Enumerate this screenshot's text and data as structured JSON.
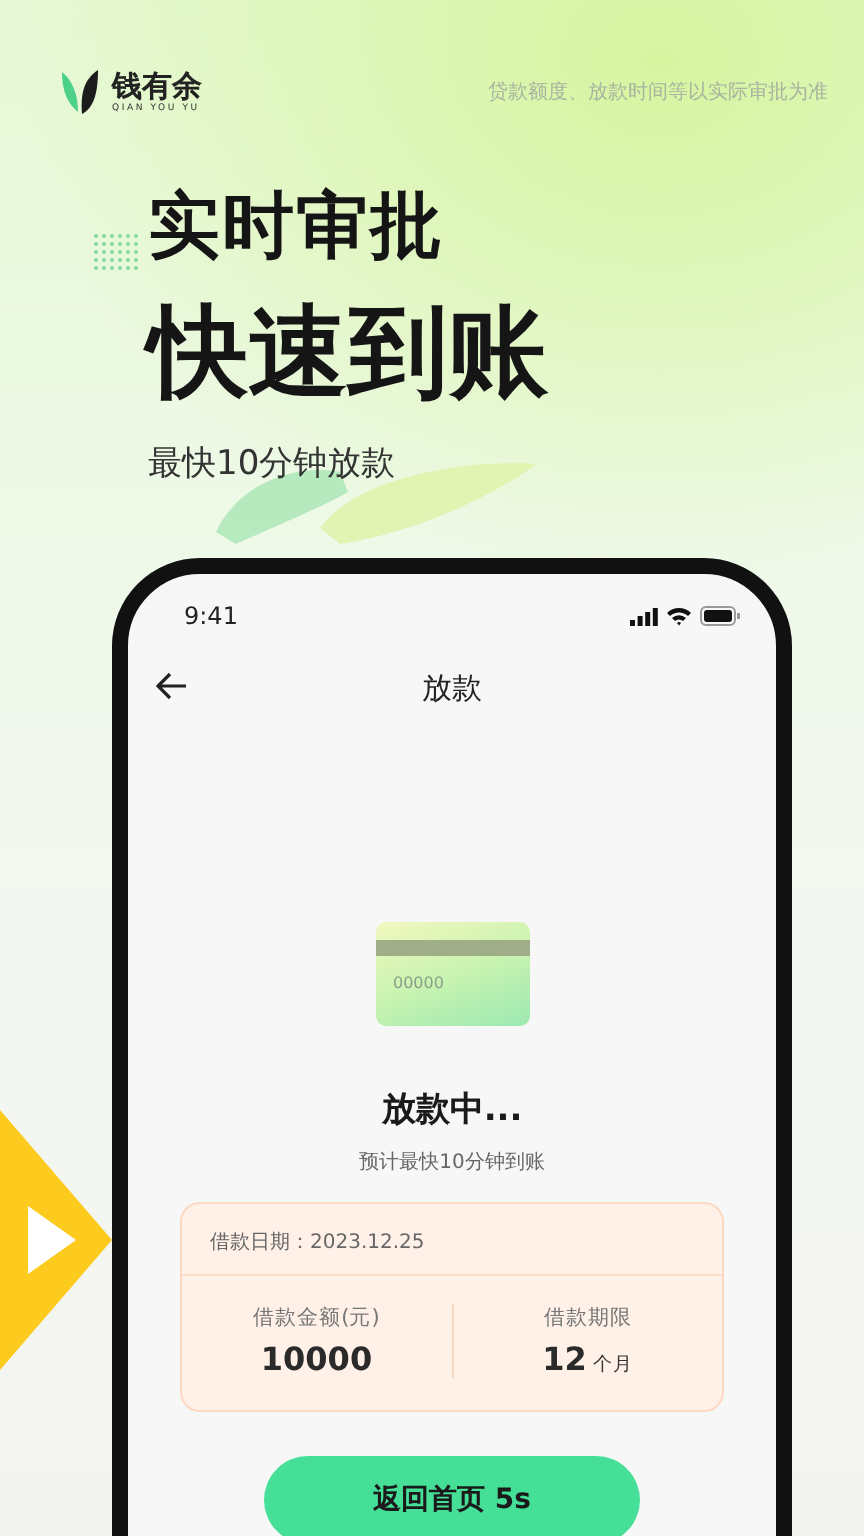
{
  "brand": {
    "name": "钱有余",
    "subtitle": "QIAN YOU YU"
  },
  "disclaimer": "贷款额度、放款时间等以实际审批为准",
  "headline": {
    "line_1": "实时审批",
    "line_2": "快速到账",
    "tagline": "最快10分钟放款"
  },
  "phone": {
    "status_bar": {
      "time": "9:41"
    },
    "nav": {
      "title": "放款"
    },
    "card_number": "00000",
    "status": {
      "title": "放款中...",
      "subtitle": "预计最快10分钟到账"
    },
    "loan": {
      "date": "借款日期：2023.12.25",
      "stats": [
        {
          "label": "借款金额(元)",
          "value": "10000"
        },
        {
          "label": "借款期限",
          "value": "12",
          "unit": "个月"
        }
      ]
    },
    "button": "返回首页 5s"
  }
}
